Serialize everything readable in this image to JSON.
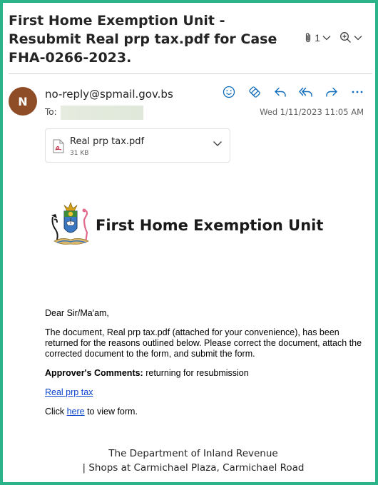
{
  "email": {
    "subject": "First Home Exemption Unit - Resubmit Real prp tax.pdf for Case FHA-0266-2023.",
    "attachment_count": "1",
    "sender_initial": "N",
    "from": "no-reply@spmail.gov.bs",
    "to_label": "To:",
    "date": "Wed 1/11/2023 11:05 AM"
  },
  "attachment": {
    "name": "Real prp tax.pdf",
    "size": "31 KB"
  },
  "body": {
    "unit_title": "First Home Exemption Unit",
    "greeting": "Dear Sir/Ma'am,",
    "paragraph": "The document, Real prp tax.pdf (attached for your convenience), has been returned for the reasons outlined below. Please correct the document, attach the corrected document to the form, and submit the form.",
    "comments_label": "Approver's Comments:",
    "comments_text": " returning for resubmission",
    "doc_link": "Real prp tax",
    "click_prefix": "Click ",
    "here_link": "here",
    "click_suffix": " to view form."
  },
  "footer": {
    "line1": "The Department of Inland Revenue",
    "line2": "| Shops at Carmichael Plaza, Carmichael Road"
  },
  "colors": {
    "frame": "#2db38a",
    "accent": "#0f6cbd",
    "avatar": "#8e4d26",
    "link": "#0b45cc"
  }
}
